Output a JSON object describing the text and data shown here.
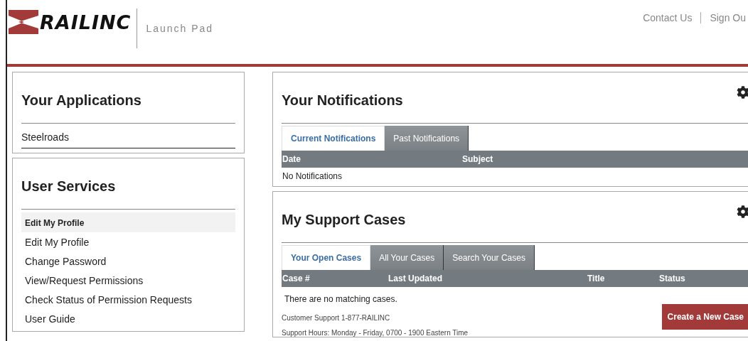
{
  "header": {
    "logo_text": "RAILINC",
    "app_title": "Launch Pad",
    "links": [
      {
        "label": "Contact Us"
      },
      {
        "label": "Sign Ou"
      }
    ]
  },
  "applications": {
    "title": "Your Applications",
    "items": [
      {
        "label": "Steelroads"
      }
    ]
  },
  "user_services": {
    "title": "User Services",
    "section_label": "Edit My Profile",
    "items": [
      {
        "label": "Edit My Profile"
      },
      {
        "label": "Change Password"
      },
      {
        "label": "View/Request Permissions"
      },
      {
        "label": "Check Status of Permission Requests"
      },
      {
        "label": "User Guide"
      }
    ]
  },
  "notifications": {
    "title": "Your Notifications",
    "tabs": [
      {
        "label": "Current Notifications",
        "selected": true
      },
      {
        "label": "Past Notifications",
        "selected": false
      }
    ],
    "columns": [
      {
        "label": "Date"
      },
      {
        "label": "Subject"
      }
    ],
    "empty_text": "No Notifications"
  },
  "support_cases": {
    "title": "My Support Cases",
    "tabs": [
      {
        "label": "Your Open Cases",
        "selected": true
      },
      {
        "label": "All Your Cases",
        "selected": false
      },
      {
        "label": "Search Your Cases",
        "selected": false
      }
    ],
    "columns": [
      {
        "label": "Case #"
      },
      {
        "label": "Last Updated"
      },
      {
        "label": "Title"
      },
      {
        "label": "Status"
      }
    ],
    "empty_text": "There are no matching cases.",
    "support_phone": "Customer Support 1-877-RAILINC",
    "support_hours": "Support Hours: Monday - Friday, 0700 - 1900 Eastern Time",
    "create_button": "Create a New Case"
  }
}
